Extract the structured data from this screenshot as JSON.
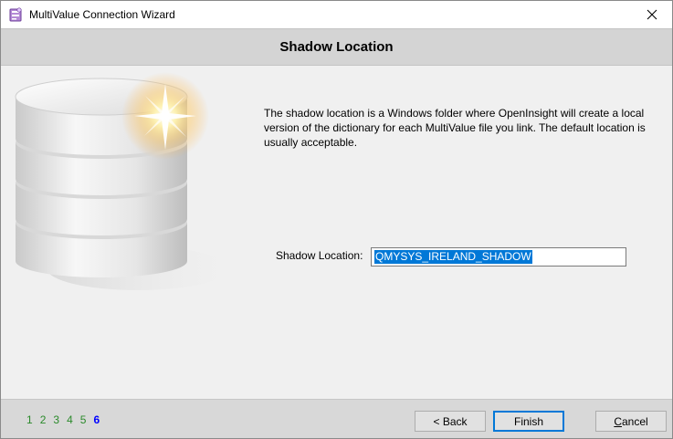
{
  "window": {
    "title": "MultiValue Connection Wizard",
    "icon": "wizard-app-icon",
    "close_icon": "close-icon"
  },
  "header": {
    "title": "Shadow Location"
  },
  "main": {
    "description": "The shadow location is a Windows folder where OpenInsight will create a local version of the dictionary for each MultiValue file you link.  The default location is usually acceptable.",
    "illustration_icon": "database-icon",
    "shadow_location": {
      "label": "Shadow Location:",
      "value": "QMYSYS_IRELAND_SHADOW"
    }
  },
  "footer": {
    "steps": [
      "1",
      "2",
      "3",
      "4",
      "5",
      "6"
    ],
    "current_step": "6",
    "back_label": "< Back",
    "finish_label": "Finish",
    "cancel_label": "Cancel",
    "step_color": "#2b8a2b",
    "current_step_color": "#0000ff",
    "focus_color": "#0078d7"
  }
}
